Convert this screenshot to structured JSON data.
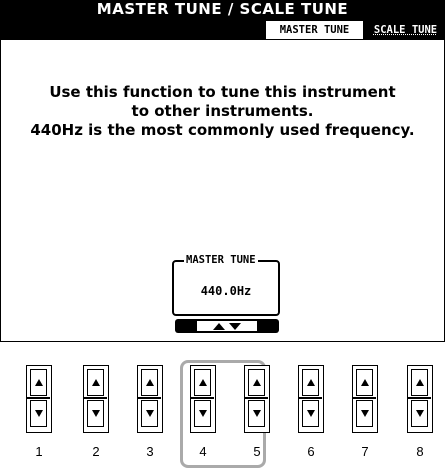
{
  "title": "MASTER TUNE / SCALE TUNE",
  "tabs": [
    {
      "label": "MASTER TUNE",
      "active": true
    },
    {
      "label": "SCALE TUNE",
      "active": false
    }
  ],
  "message": {
    "line1": "Use this function to tune this instrument",
    "line2": "to other instruments.",
    "line3": "440Hz is the most commonly used frequency."
  },
  "master_tune": {
    "label": "MASTER TUNE",
    "value": "440.0Hz"
  },
  "buttons": {
    "numbers": [
      "1",
      "2",
      "3",
      "4",
      "5",
      "6",
      "7",
      "8"
    ],
    "highlighted": [
      "4",
      "5"
    ]
  },
  "colors": {
    "lcd_background": "#ffffff",
    "lcd_foreground": "#000000",
    "highlight_frame": "#aaaaaa"
  },
  "icons": {
    "up": "triangle-up-icon",
    "down": "triangle-down-icon"
  }
}
